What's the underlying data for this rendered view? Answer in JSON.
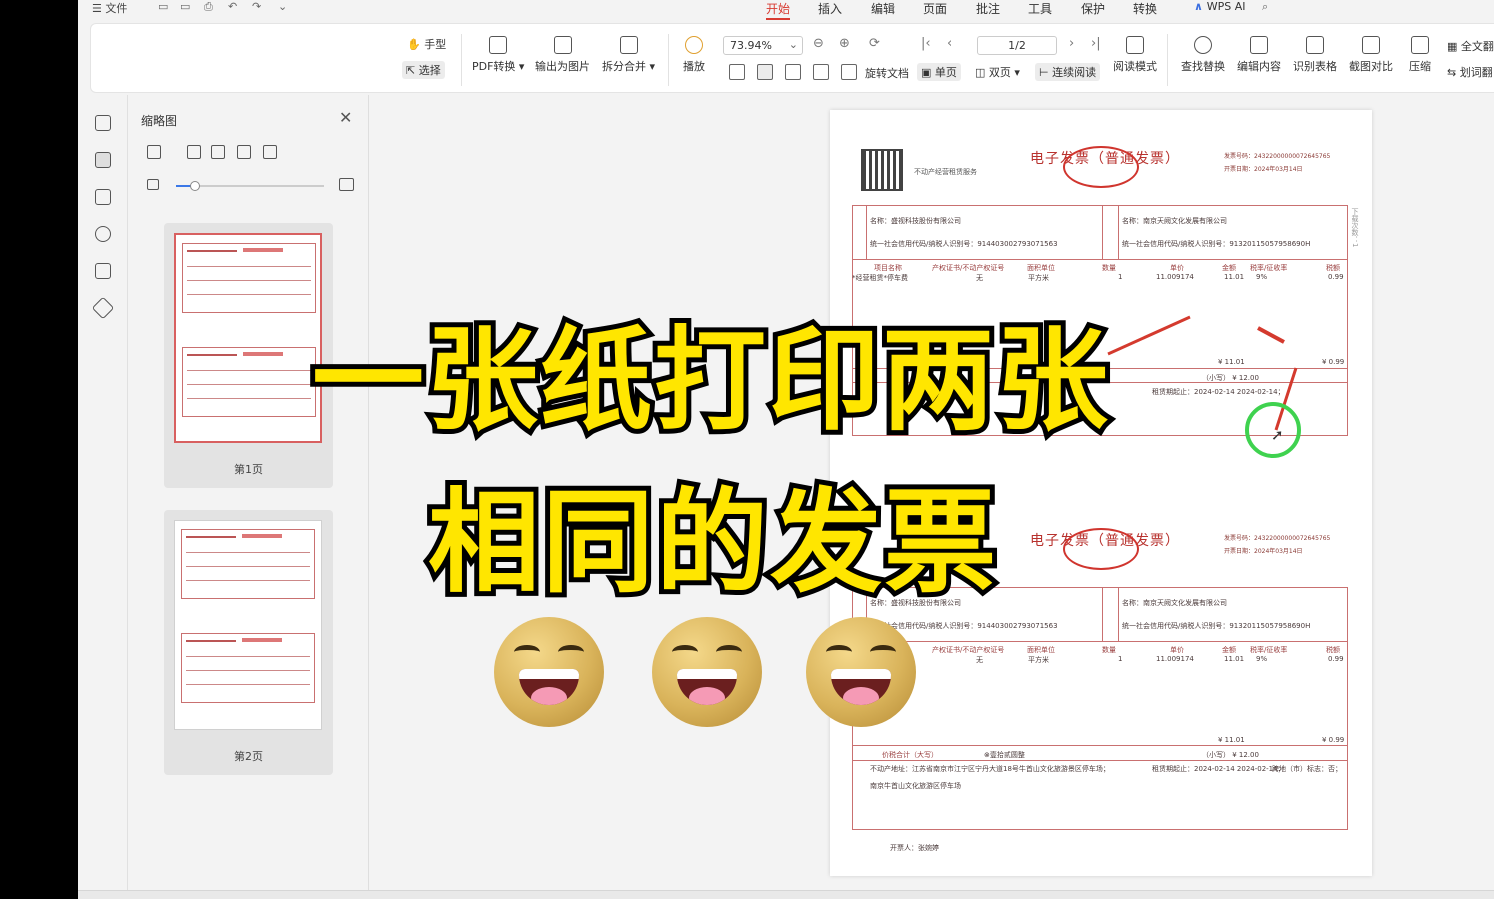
{
  "menubar": {
    "file": "☰ 文件",
    "tabs": [
      "开始",
      "插入",
      "编辑",
      "页面",
      "批注",
      "工具",
      "保护",
      "转换"
    ],
    "active_tab": "开始",
    "wps_ai": "WPS AI"
  },
  "ribbon": {
    "hand": "手型",
    "select": "选择",
    "pdf_convert": "PDF转换",
    "export_image": "输出为图片",
    "split_merge": "拆分合并",
    "play": "播放",
    "zoom": "73.94%",
    "page_indicator": "1/2",
    "rotate": "旋转文档",
    "single": "单页",
    "double": "双页",
    "continuous": "连续阅读",
    "read_mode": "阅读模式",
    "find_replace": "查找替换",
    "edit_content": "编辑内容",
    "recognize_table": "识别表格",
    "screenshot_compare": "截图对比",
    "compress": "压缩",
    "full_text": "全文翻",
    "word_translate": "划词翻"
  },
  "thumbnails": {
    "title": "缩略图",
    "pages": [
      {
        "label": "第1页"
      },
      {
        "label": "第2页"
      }
    ]
  },
  "invoice": {
    "title": "电子发票（普通发票）",
    "service": "不动产经营租赁服务",
    "invoice_no_label": "发票号码：",
    "invoice_no": "24322000000072645765",
    "date_label": "开票日期：",
    "date": "2024年03月14日",
    "buyer_name": "名称：盛视科技股份有限公司",
    "buyer_tax": "统一社会信用代码/纳税人识别号：914403002793071563",
    "seller_name": "名称：南京天阙文化发展有限公司",
    "seller_tax": "统一社会信用代码/纳税人识别号：91320115057958690H",
    "header_cols": [
      "项目名称",
      "产权证书/不动产权证号",
      "面积单位",
      "数量",
      "单价",
      "金额",
      "税率/征收率",
      "税额"
    ],
    "row": [
      "*经营租赁*停车费",
      "无",
      "平方米",
      "1",
      "11.009174",
      "11.01",
      "9%",
      "0.99"
    ],
    "total_amount": "¥ 11.01",
    "total_tax": "¥ 0.99",
    "total_words_label": "价税合计（大写）",
    "total_words": "壹拾贰圆整",
    "total_small": "（小写） ¥ 12.00",
    "remark_address": "不动产地址：江苏省南京市江宁区宁丹大道18号牛首山文化旅游景区停车场；",
    "remark_period": "租赁期起止：2024-02-14 2024-02-14；",
    "remark_cross": "跨地（市）标志：否；",
    "remark_place": "南京牛首山文化旅游区停车场",
    "issuer": "开票人：张婉婷",
    "side_note": "下载次数：1"
  },
  "overlay": {
    "line1": "一张纸打印两张",
    "line2": "相同的发票"
  },
  "colors": {
    "accent": "#d83b32",
    "caption_fill": "#ffe600",
    "caption_stroke": "#000000",
    "invoice_line": "#c97070",
    "annotation_green": "#3fd24f"
  }
}
